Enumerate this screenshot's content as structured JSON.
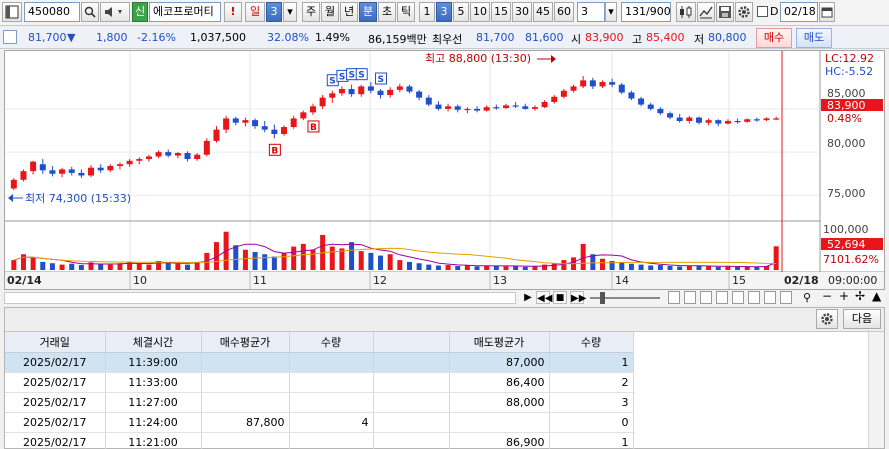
{
  "toolbar": {
    "code": "450080",
    "credit_badge": "신",
    "stock_name": "에코프로머티",
    "period_buttons": [
      "일",
      "3",
      "주",
      "월",
      "년",
      "분",
      "초",
      "틱"
    ],
    "minute_buttons": [
      "1",
      "3",
      "5",
      "10",
      "15",
      "30",
      "45",
      "60"
    ],
    "count_select": "3",
    "page_counter": "131/900",
    "d_label": "D",
    "date": "02/18"
  },
  "infobar": {
    "price": "81,700",
    "arrow": "▼",
    "change": "1,800",
    "change_pct": "-2.16%",
    "volume": "1,037,500",
    "vol_ratio": "32.08%",
    "turnover": "1.49%",
    "amount": "86,159백만",
    "best_label": "최우선",
    "ask": "81,700",
    "bid": "81,600",
    "open_label": "시",
    "open": "83,900",
    "high_label": "고",
    "high": "85,400",
    "low_label": "저",
    "low": "80,800",
    "buy_btn": "매수",
    "sell_btn": "매도"
  },
  "chart": {
    "max_annotation": "최고 88,800 (13:30)",
    "min_annotation": "최저 74,300 (15:33)",
    "lc_label": "LC:12.92",
    "hc_label": "HC:-5.52",
    "price_axis": [
      "85,000",
      "80,000",
      "75,000"
    ],
    "current_price_tag": "83,900",
    "current_pct_tag": "0.48%",
    "volume_axis_top": "100,000",
    "volume_tag": "52,694",
    "volume_pct_tag": "7101.62%",
    "date_labels": [
      "02/14",
      "10",
      "11",
      "12",
      "13",
      "14",
      "15"
    ],
    "right_date": "02/18",
    "right_time": "09:00:00",
    "signals": [
      "B",
      "B",
      "S",
      "S",
      "S",
      "S",
      "S"
    ]
  },
  "colors": {
    "up": "#e8151b",
    "down": "#1f4fc9",
    "selected_row": "#cfe3f2"
  },
  "chart_data": {
    "type": "candlestick",
    "ylim": [
      72500,
      91000
    ],
    "bars": [
      [
        75.8,
        77.0,
        75.6,
        76.8
      ],
      [
        76.8,
        78.0,
        76.6,
        77.8
      ],
      [
        77.8,
        79.0,
        77.4,
        78.9
      ],
      [
        78.6,
        79.2,
        77.5,
        77.9
      ],
      [
        77.9,
        78.4,
        77.2,
        77.5
      ],
      [
        77.5,
        78.2,
        77.1,
        78.0
      ],
      [
        78.0,
        78.3,
        77.3,
        77.6
      ],
      [
        77.6,
        78.0,
        77.0,
        77.3
      ],
      [
        77.3,
        78.5,
        77.1,
        78.2
      ],
      [
        78.2,
        78.6,
        77.6,
        77.9
      ],
      [
        77.9,
        78.6,
        77.7,
        78.4
      ],
      [
        78.4,
        78.8,
        78.0,
        78.6
      ],
      [
        78.6,
        79.2,
        78.3,
        79.0
      ],
      [
        79.0,
        79.4,
        78.6,
        79.2
      ],
      [
        79.2,
        79.7,
        78.9,
        79.5
      ],
      [
        79.5,
        80.2,
        79.3,
        80.0
      ],
      [
        80.0,
        80.3,
        79.4,
        79.6
      ],
      [
        79.6,
        80.0,
        79.3,
        79.9
      ],
      [
        79.9,
        80.1,
        78.9,
        79.2
      ],
      [
        79.2,
        79.9,
        79.0,
        79.7
      ],
      [
        79.7,
        81.6,
        79.5,
        81.3
      ],
      [
        81.3,
        83.0,
        81.1,
        82.6
      ],
      [
        82.6,
        84.2,
        82.2,
        83.9
      ],
      [
        83.9,
        84.1,
        83.1,
        83.4
      ],
      [
        83.4,
        84.0,
        83.0,
        83.7
      ],
      [
        83.7,
        83.9,
        82.7,
        83.0
      ],
      [
        83.0,
        83.6,
        82.3,
        82.6
      ],
      [
        82.6,
        83.2,
        81.6,
        82.1
      ],
      [
        82.1,
        83.1,
        81.9,
        82.9
      ],
      [
        82.9,
        84.2,
        82.7,
        83.9
      ],
      [
        83.9,
        84.8,
        83.7,
        84.6
      ],
      [
        84.6,
        85.6,
        84.3,
        85.3
      ],
      [
        85.3,
        86.6,
        85.0,
        86.3
      ],
      [
        86.3,
        87.1,
        85.7,
        86.8
      ],
      [
        86.8,
        87.6,
        86.5,
        87.3
      ],
      [
        87.3,
        87.8,
        86.4,
        86.7
      ],
      [
        86.7,
        87.8,
        86.4,
        87.6
      ],
      [
        87.6,
        88.1,
        86.8,
        87.1
      ],
      [
        87.1,
        87.3,
        86.2,
        86.6
      ],
      [
        86.6,
        87.5,
        86.3,
        87.2
      ],
      [
        87.2,
        87.9,
        86.9,
        87.6
      ],
      [
        87.6,
        87.8,
        86.8,
        87.0
      ],
      [
        87.0,
        87.2,
        86.0,
        86.3
      ],
      [
        86.3,
        86.6,
        85.3,
        85.5
      ],
      [
        85.5,
        85.9,
        84.8,
        85.0
      ],
      [
        85.0,
        85.6,
        84.7,
        85.3
      ],
      [
        85.3,
        85.5,
        84.6,
        84.9
      ],
      [
        84.9,
        85.2,
        84.5,
        85.0
      ],
      [
        85.0,
        85.3,
        84.6,
        84.8
      ],
      [
        84.8,
        85.4,
        84.7,
        85.2
      ],
      [
        85.2,
        85.5,
        84.9,
        85.1
      ],
      [
        85.1,
        85.6,
        85.0,
        85.4
      ],
      [
        85.4,
        85.8,
        85.1,
        85.3
      ],
      [
        85.3,
        85.6,
        84.9,
        85.0
      ],
      [
        85.0,
        85.4,
        84.8,
        85.2
      ],
      [
        85.2,
        86.0,
        85.1,
        85.8
      ],
      [
        85.8,
        86.6,
        85.6,
        86.4
      ],
      [
        86.4,
        87.3,
        86.2,
        87.1
      ],
      [
        87.1,
        87.8,
        86.9,
        87.6
      ],
      [
        87.6,
        88.8,
        87.4,
        88.3
      ],
      [
        88.3,
        88.6,
        87.3,
        87.6
      ],
      [
        87.6,
        88.3,
        87.4,
        88.1
      ],
      [
        88.1,
        88.5,
        87.5,
        87.8
      ],
      [
        87.8,
        88.0,
        86.7,
        86.9
      ],
      [
        86.9,
        87.1,
        86.0,
        86.2
      ],
      [
        86.2,
        86.4,
        85.3,
        85.5
      ],
      [
        85.5,
        85.7,
        84.8,
        85.0
      ],
      [
        85.0,
        85.2,
        84.3,
        84.5
      ],
      [
        84.5,
        84.7,
        83.8,
        84.0
      ],
      [
        84.0,
        84.4,
        83.4,
        83.6
      ],
      [
        83.6,
        84.2,
        83.3,
        84.0
      ],
      [
        84.0,
        84.1,
        83.2,
        83.4
      ],
      [
        83.4,
        83.9,
        83.1,
        83.7
      ],
      [
        83.7,
        83.8,
        83.0,
        83.3
      ],
      [
        83.3,
        83.8,
        83.2,
        83.6
      ],
      [
        83.6,
        83.9,
        83.3,
        83.5
      ],
      [
        83.5,
        83.9,
        83.4,
        83.8
      ],
      [
        83.8,
        84.0,
        83.5,
        83.7
      ],
      [
        83.7,
        84.0,
        83.6,
        83.9
      ],
      [
        83.9,
        84.1,
        83.7,
        83.9
      ]
    ],
    "volume_max": 100000,
    "volumes": [
      22000,
      35000,
      28000,
      18000,
      15000,
      12000,
      14000,
      11000,
      17000,
      13000,
      12000,
      15000,
      18000,
      14000,
      12000,
      20000,
      16000,
      14000,
      12000,
      18000,
      38000,
      62000,
      85000,
      55000,
      45000,
      40000,
      35000,
      30000,
      38000,
      52000,
      58000,
      45000,
      78000,
      52000,
      48000,
      62000,
      42000,
      38000,
      32000,
      35000,
      22000,
      18000,
      15000,
      12000,
      10000,
      11000,
      9000,
      10000,
      8000,
      9000,
      10000,
      8000,
      9000,
      7000,
      8000,
      12000,
      15000,
      22000,
      28000,
      58000,
      35000,
      25000,
      20000,
      18000,
      14000,
      12000,
      10000,
      11000,
      9000,
      8000,
      10000,
      9000,
      8000,
      7000,
      8000,
      7000,
      8000,
      7000,
      9000,
      52694
    ]
  },
  "table": {
    "toolbar_next": "다음",
    "headers": [
      "거래일",
      "체결시간",
      "매수평균가",
      "수량",
      "",
      "매도평균가",
      "수량"
    ],
    "rows": [
      [
        "2025/02/17",
        "11:39:00",
        "",
        "",
        "",
        "87,000",
        "1"
      ],
      [
        "2025/02/17",
        "11:33:00",
        "",
        "",
        "",
        "86,400",
        "2"
      ],
      [
        "2025/02/17",
        "11:27:00",
        "",
        "",
        "",
        "88,000",
        "3"
      ],
      [
        "2025/02/17",
        "11:24:00",
        "87,800",
        "4",
        "",
        "",
        "0"
      ],
      [
        "2025/02/17",
        "11:21:00",
        "",
        "",
        "",
        "86,900",
        "1"
      ]
    ]
  }
}
